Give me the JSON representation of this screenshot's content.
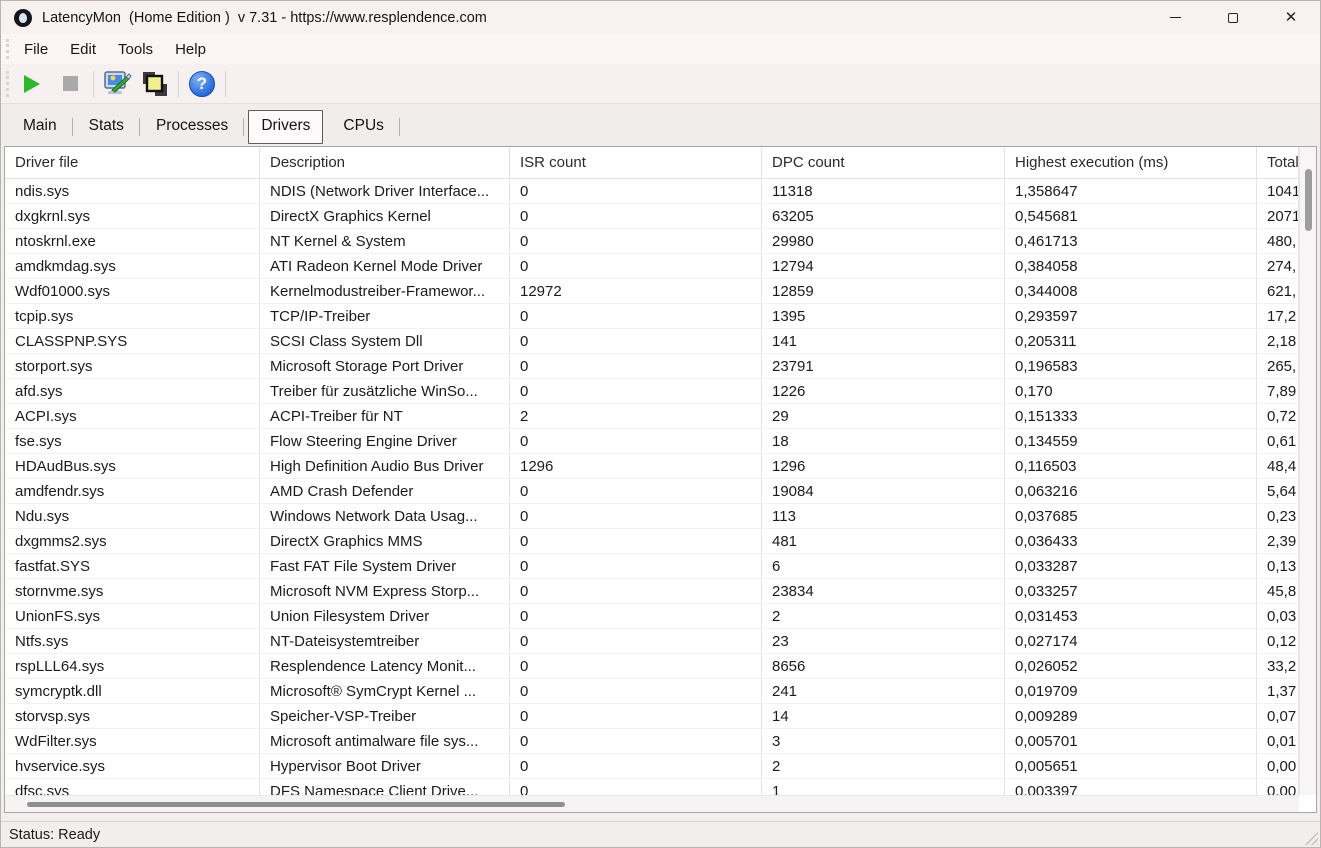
{
  "window": {
    "title": "LatencyMon  (Home Edition )  v 7.31 - https://www.resplendence.com",
    "controls": {
      "minimize": "minimize",
      "maximize": "maximize",
      "close": "close"
    }
  },
  "menu": {
    "items": [
      {
        "label": "File"
      },
      {
        "label": "Edit"
      },
      {
        "label": "Tools"
      },
      {
        "label": "Help"
      }
    ]
  },
  "toolbar": {
    "buttons": [
      {
        "name": "start-monitor-button",
        "icon": "play-icon",
        "color": "#2db82d"
      },
      {
        "name": "stop-monitor-button",
        "icon": "stop-icon",
        "color": "#a9a9a9"
      },
      {
        "name": "options-button",
        "icon": "monitor-tool-icon",
        "colors": {
          "screen": "#4a8ae0",
          "tool": "#3aa53a"
        }
      },
      {
        "name": "processes-button",
        "icon": "overlapping-squares-icon",
        "colors": {
          "front": "#f0ee8e",
          "back": "#3a3a3a"
        }
      },
      {
        "name": "help-button",
        "icon": "question-icon",
        "glyph": "?",
        "color": "#2f6fe0"
      }
    ]
  },
  "tabs": {
    "selected": "Drivers",
    "items": [
      {
        "label": "Main"
      },
      {
        "label": "Stats"
      },
      {
        "label": "Processes"
      },
      {
        "label": "Drivers"
      },
      {
        "label": "CPUs"
      }
    ]
  },
  "table": {
    "columns": [
      "Driver file",
      "Description",
      "ISR count",
      "DPC count",
      "Highest execution (ms)",
      "Total"
    ],
    "rows": [
      [
        "ndis.sys",
        "NDIS (Network Driver Interface...",
        "0",
        "11318",
        "1,358647",
        "1041"
      ],
      [
        "dxgkrnl.sys",
        "DirectX Graphics Kernel",
        "0",
        "63205",
        "0,545681",
        "2071"
      ],
      [
        "ntoskrnl.exe",
        "NT Kernel & System",
        "0",
        "29980",
        "0,461713",
        "480,"
      ],
      [
        "amdkmdag.sys",
        "ATI Radeon Kernel Mode Driver",
        "0",
        "12794",
        "0,384058",
        "274,"
      ],
      [
        "Wdf01000.sys",
        "Kernelmodustreiber-Framewor...",
        "12972",
        "12859",
        "0,344008",
        "621,"
      ],
      [
        "tcpip.sys",
        "TCP/IP-Treiber",
        "0",
        "1395",
        "0,293597",
        "17,2"
      ],
      [
        "CLASSPNP.SYS",
        "SCSI Class System Dll",
        "0",
        "141",
        "0,205311",
        "2,18"
      ],
      [
        "storport.sys",
        "Microsoft Storage Port Driver",
        "0",
        "23791",
        "0,196583",
        "265,"
      ],
      [
        "afd.sys",
        "Treiber für zusätzliche WinSo...",
        "0",
        "1226",
        "0,170",
        "7,89"
      ],
      [
        "ACPI.sys",
        "ACPI-Treiber für NT",
        "2",
        "29",
        "0,151333",
        "0,72"
      ],
      [
        "fse.sys",
        "Flow Steering Engine Driver",
        "0",
        "18",
        "0,134559",
        "0,61"
      ],
      [
        "HDAudBus.sys",
        "High Definition Audio Bus Driver",
        "1296",
        "1296",
        "0,116503",
        "48,4"
      ],
      [
        "amdfendr.sys",
        "AMD Crash Defender",
        "0",
        "19084",
        "0,063216",
        "5,64"
      ],
      [
        "Ndu.sys",
        "Windows Network Data Usag...",
        "0",
        "113",
        "0,037685",
        "0,23"
      ],
      [
        "dxgmms2.sys",
        "DirectX Graphics MMS",
        "0",
        "481",
        "0,036433",
        "2,39"
      ],
      [
        "fastfat.SYS",
        "Fast FAT File System Driver",
        "0",
        "6",
        "0,033287",
        "0,13"
      ],
      [
        "stornvme.sys",
        "Microsoft NVM Express Storp...",
        "0",
        "23834",
        "0,033257",
        "45,8"
      ],
      [
        "UnionFS.sys",
        "Union Filesystem Driver",
        "0",
        "2",
        "0,031453",
        "0,03"
      ],
      [
        "Ntfs.sys",
        "NT-Dateisystemtreiber",
        "0",
        "23",
        "0,027174",
        "0,12"
      ],
      [
        "rspLLL64.sys",
        "Resplendence Latency Monit...",
        "0",
        "8656",
        "0,026052",
        "33,2"
      ],
      [
        "symcryptk.dll",
        "Microsoft® SymCrypt Kernel ...",
        "0",
        "241",
        "0,019709",
        "1,37"
      ],
      [
        "storvsp.sys",
        "Speicher-VSP-Treiber",
        "0",
        "14",
        "0,009289",
        "0,07"
      ],
      [
        "WdFilter.sys",
        "Microsoft antimalware file sys...",
        "0",
        "3",
        "0,005701",
        "0,01"
      ],
      [
        "hvservice.sys",
        "Hypervisor Boot Driver",
        "0",
        "2",
        "0,005651",
        "0,00"
      ],
      [
        "dfsc.sys",
        "DFS Namespace Client Drive...",
        "0",
        "1",
        "0,003397",
        "0,00"
      ]
    ]
  },
  "statusbar": {
    "text": "Status: Ready"
  }
}
